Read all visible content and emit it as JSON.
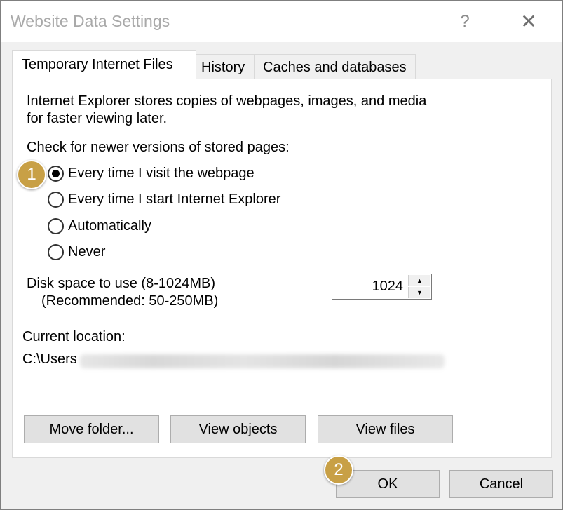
{
  "window": {
    "title": "Website Data Settings",
    "help_glyph": "?",
    "close_glyph": "✕"
  },
  "tabs": [
    {
      "label": "Temporary Internet Files",
      "active": true
    },
    {
      "label": "History",
      "active": false
    },
    {
      "label": "Caches and databases",
      "active": false
    }
  ],
  "panel": {
    "description_line1": "Internet Explorer stores copies of webpages, images, and media",
    "description_line2": "for faster viewing later.",
    "check_label": "Check for newer versions of stored pages:",
    "options": [
      {
        "label": "Every time I visit the webpage",
        "selected": true
      },
      {
        "label": "Every time I start Internet Explorer",
        "selected": false
      },
      {
        "label": "Automatically",
        "selected": false
      },
      {
        "label": "Never",
        "selected": false
      }
    ],
    "disk_label_line1": "Disk space to use (8-1024MB)",
    "disk_label_line2": "(Recommended: 50-250MB)",
    "disk_value": "1024",
    "current_location_label": "Current location:",
    "current_location_path": "C:\\Users",
    "buttons": {
      "move_folder": "Move folder...",
      "view_objects": "View objects",
      "view_files": "View files"
    }
  },
  "footer": {
    "ok": "OK",
    "cancel": "Cancel"
  },
  "annotations": {
    "badge1": "1",
    "badge2": "2",
    "badge_color": "#c8a046"
  }
}
